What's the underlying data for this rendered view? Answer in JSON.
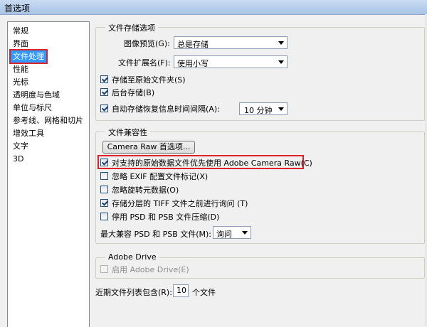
{
  "window": {
    "title": "首选项"
  },
  "sidebar": {
    "items": [
      {
        "label": "常规"
      },
      {
        "label": "界面"
      },
      {
        "label": "文件处理",
        "selected": true
      },
      {
        "label": "性能"
      },
      {
        "label": "光标"
      },
      {
        "label": "透明度与色域"
      },
      {
        "label": "单位与标尺"
      },
      {
        "label": "参考线、网格和切片"
      },
      {
        "label": "增效工具"
      },
      {
        "label": "文字"
      },
      {
        "label": "3D"
      }
    ]
  },
  "file_save": {
    "legend": "文件存储选项",
    "image_preview_label": "图像预览(G):",
    "image_preview_value": "总是存储",
    "extension_label": "文件扩展名(F):",
    "extension_value": "使用小写",
    "save_in_original": {
      "label": "存储至原始文件夹(S)",
      "checked": true
    },
    "background_save": {
      "label": "后台存储(B)",
      "checked": true
    },
    "auto_save": {
      "label": "自动存储恢复信息时间间隔(A):",
      "checked": true
    },
    "auto_save_interval": "10 分钟"
  },
  "compat": {
    "legend": "文件兼容性",
    "camera_raw_button": "Camera Raw 首选项...",
    "prefer_camera_raw": {
      "label": "对支持的原始数据文件优先使用 Adobe Camera Raw(C)",
      "checked": true
    },
    "ignore_exif": {
      "label": "忽略 EXIF 配置文件标记(X)",
      "checked": false
    },
    "ignore_rotation": {
      "label": "忽略旋转元数据(O)",
      "checked": false
    },
    "ask_tiff": {
      "label": "存储分层的 TIFF 文件之前进行询问 (T)",
      "checked": true
    },
    "disable_psd_compress": {
      "label": "停用 PSD 和 PSB 文件压缩(D)",
      "checked": false
    },
    "max_compat_label": "最大兼容 PSD 和 PSB 文件(M):",
    "max_compat_value": "询问"
  },
  "drive": {
    "legend": "Adobe Drive",
    "enable": {
      "label": "启用 Adobe Drive(E)",
      "checked": false,
      "disabled": true
    }
  },
  "recent": {
    "label_before": "近期文件列表包含(R):",
    "value": "10",
    "label_after": "个文件"
  }
}
